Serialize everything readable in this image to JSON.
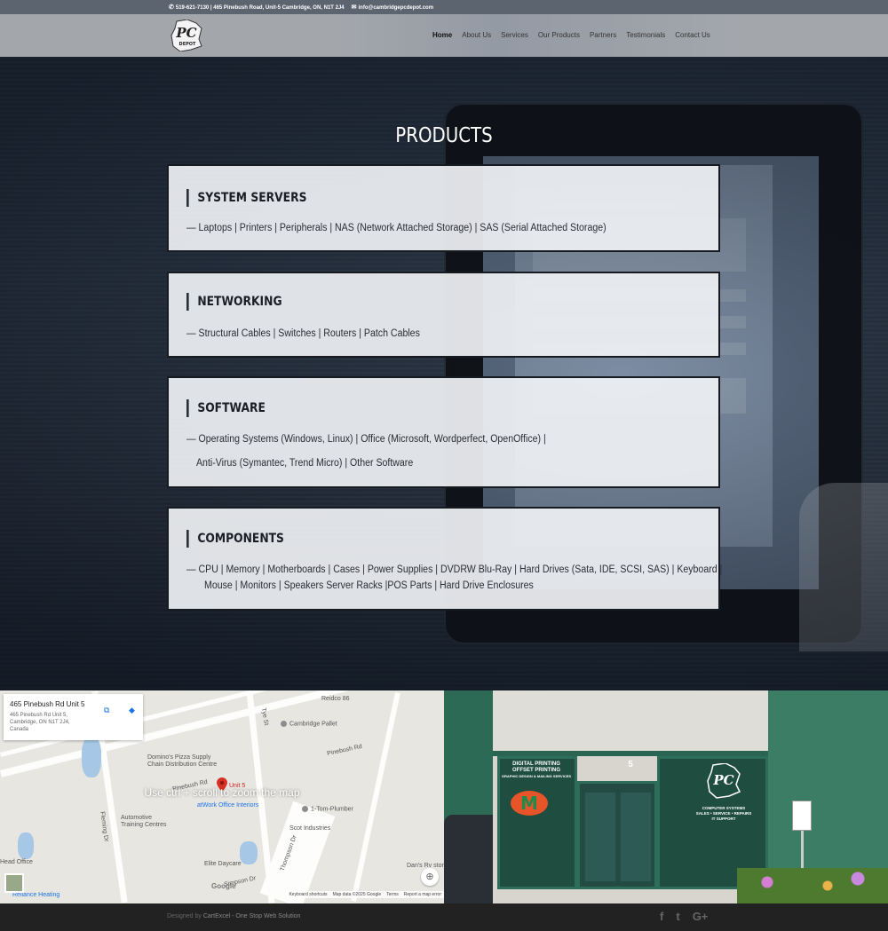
{
  "topbar": {
    "contact": "519-621-7130 | 465 Pinebush Road, Unit-5 Cambridge, ON, N1T 2J4",
    "email": "info@cambridgepcdepot.com",
    "phone_icon": "phone-icon",
    "mail_icon": "mail-icon"
  },
  "header": {
    "logo_text": "PC",
    "logo_sub": "DEPOT",
    "nav": [
      {
        "label": "Home",
        "active": true
      },
      {
        "label": "About Us"
      },
      {
        "label": "Services"
      },
      {
        "label": "Our Products"
      },
      {
        "label": "Partners"
      },
      {
        "label": "Testimonials"
      },
      {
        "label": "Contact Us"
      }
    ]
  },
  "main": {
    "title": "PRODUCTS",
    "cards": [
      {
        "heading": "SYSTEM SERVERS",
        "lines": [
          "— Laptops | Printers | Peripherals | NAS (Network Attached Storage) | SAS (Serial Attached Storage)"
        ]
      },
      {
        "heading": "NETWORKING",
        "lines": [
          "— Structural Cables | Switches | Routers | Patch Cables"
        ]
      },
      {
        "heading": "SOFTWARE",
        "lines": [
          "— Operating Systems (Windows, Linux) | Office (Microsoft, Wordperfect, OpenOffice) |",
          "Anti-Virus (Symantec, Trend Micro) | Other Software"
        ]
      },
      {
        "heading": "COMPONENTS",
        "lines": [
          "— CPU | Memory | Motherboards | Cases | Power Supplies | DVDRW  Blu-Ray | Hard Drives (Sata, IDE, SCSI, SAS) | Keyboard |",
          "Mouse | Monitors | Speakers  Server Racks |POS Parts | Hard Drive Enclosures"
        ]
      }
    ]
  },
  "map": {
    "place_name": "465 Pinebush Rd Unit 5",
    "place_address": "465 Pinebush Rd Unit 5, Cambridge, ON N1T 2J4, Canada",
    "overlay": "Use ctrl + scroll to zoom the map",
    "pin_label": "Unit 5",
    "labels": [
      "Reidco 86",
      "Cambridge Pallet",
      "Domino's Pizza Supply Chain Distribution Centre",
      "Pinebush Rd",
      "Pinebush Rd",
      "atWork Office Interiors",
      "1-Tom-Plumber",
      "Automotive Training Centres",
      "Scot Industries",
      "Elite Daycare",
      "Head Office",
      "Reliance Heating",
      "Dan's Rv stor",
      "Tye St",
      "Thompson Dr",
      "Simpson Dr",
      "Fleming Dr"
    ],
    "attribution": [
      "Keyboard shortcuts",
      "Map data ©2025 Google",
      "Terms",
      "Report a map error"
    ],
    "google": "Google"
  },
  "storefront": {
    "sign_left_1": "DIGITAL PRINTING",
    "sign_left_2": "OFFSET PRINTING",
    "sign_left_3": "GRAPHIC DESIGN & MAILING SERVICES",
    "unit": "5",
    "sign_right_1": "COMPUTER SYSTEMS",
    "sign_right_2": "SALES • SERVICE • REPAIRS",
    "sign_right_3": "IT SUPPORT"
  },
  "footer": {
    "designed_by": "Designed by ",
    "company": "CartExcel - One Stop Web Solution",
    "social": [
      "f",
      "t",
      "G+"
    ]
  }
}
